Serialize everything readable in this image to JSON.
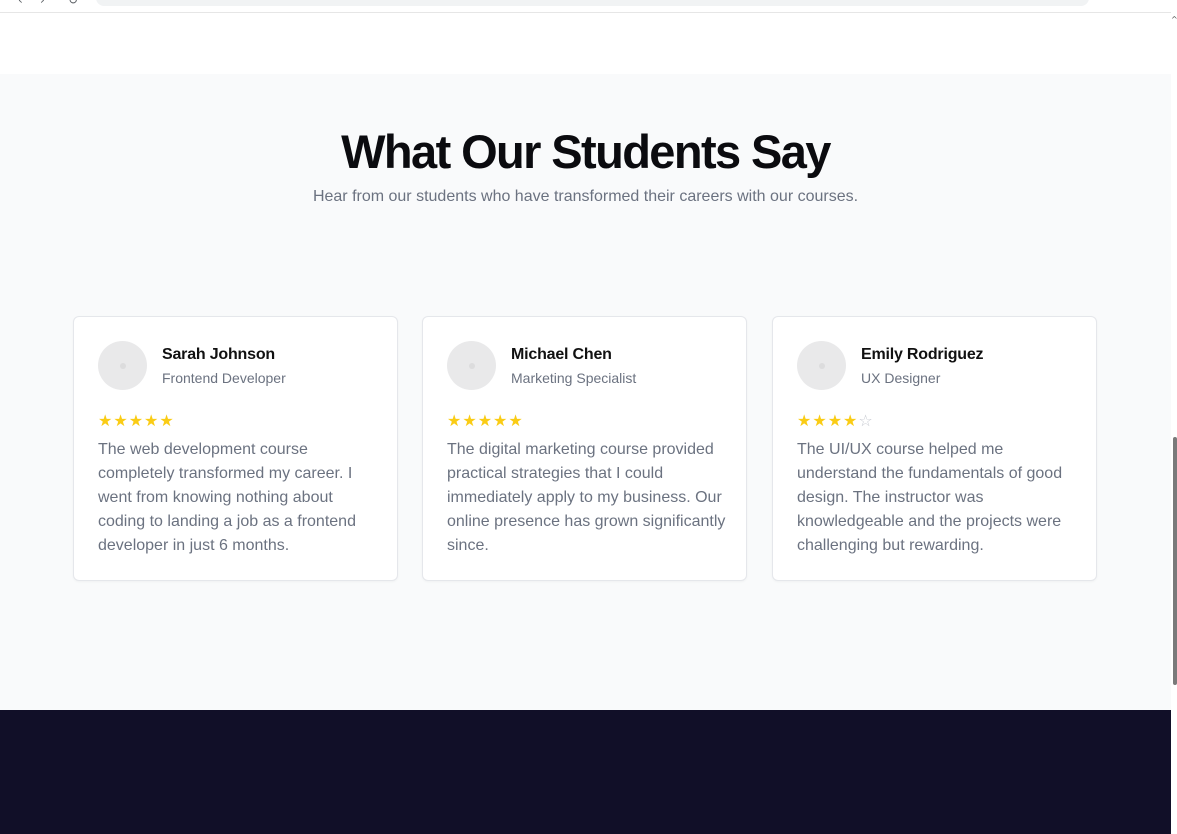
{
  "browser": {
    "back_icon": "‹",
    "forward_icon": "›",
    "reload_icon": "↻"
  },
  "testimonials": {
    "title": "What Our Students Say",
    "subtitle": "Hear from our students who have transformed their careers with our courses.",
    "star_color": "#facc15",
    "cards": [
      {
        "name": "Sarah Johnson",
        "role": "Frontend Developer",
        "rating": 5,
        "quote": "The web development course completely transformed my career. I went from knowing nothing about coding to landing a job as a frontend developer in just 6 months."
      },
      {
        "name": "Michael Chen",
        "role": "Marketing Specialist",
        "rating": 5,
        "quote": "The digital marketing course provided practical strategies that I could immediately apply to my business. Our online presence has grown significantly since."
      },
      {
        "name": "Emily Rodriguez",
        "role": "UX Designer",
        "rating": 4,
        "quote": "The UI/UX course helped me understand the fundamentals of good design. The instructor was knowledgeable and the projects were challenging but rewarding."
      }
    ]
  },
  "colors": {
    "section_bg": "#f9fafb",
    "footer_bg": "#110f28",
    "text_muted": "#6b7280"
  }
}
